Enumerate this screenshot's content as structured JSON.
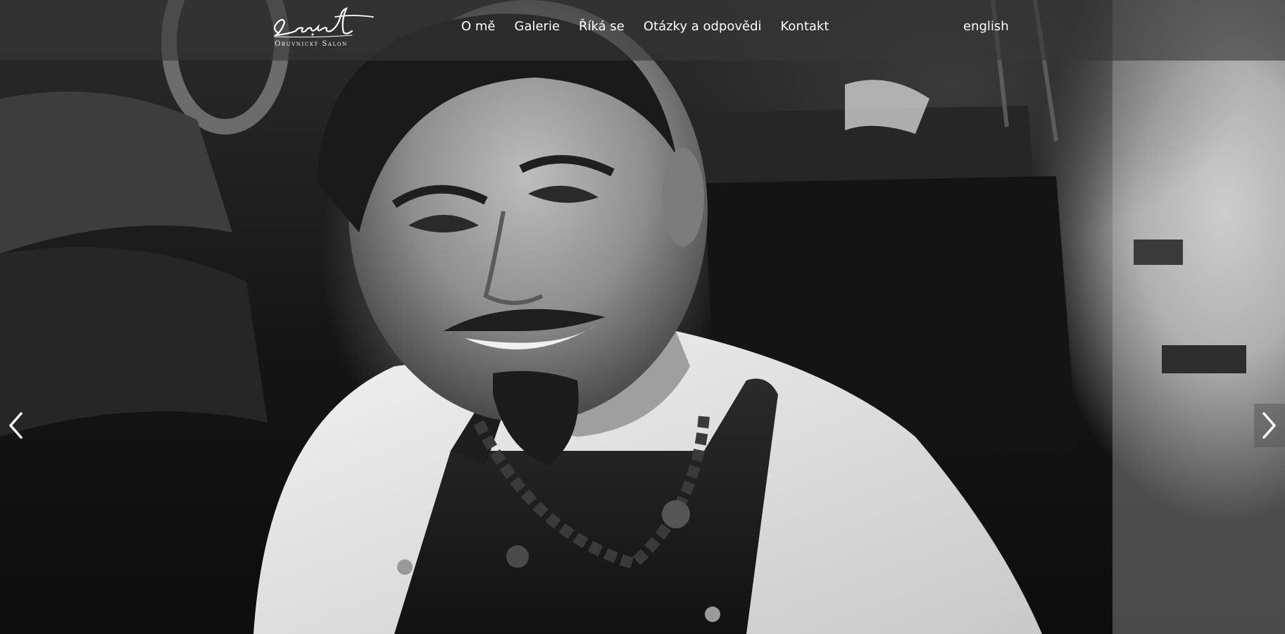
{
  "brand": {
    "logo_script": "Lavart",
    "logo_subtitle": "Obuvnický Salon"
  },
  "nav": {
    "items": [
      {
        "label": "O mě"
      },
      {
        "label": "Galerie"
      },
      {
        "label": "Říká se"
      },
      {
        "label": "Otázky a odpovědi"
      },
      {
        "label": "Kontakt"
      }
    ],
    "language": "english"
  },
  "slider": {
    "prev_icon": "chevron-left-icon",
    "next_icon": "chevron-right-icon"
  },
  "colors": {
    "nav_text": "#ffffff",
    "topbar_bg": "rgba(55,55,55,0.62)"
  }
}
